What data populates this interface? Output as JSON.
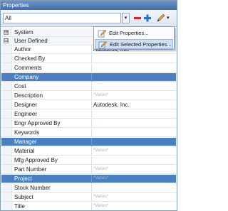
{
  "window": {
    "title": "Properties"
  },
  "toolbar": {
    "filter_value": "All"
  },
  "menu": {
    "items": [
      {
        "label": "Edit Properties..."
      },
      {
        "label": "Edit Selected Properties..."
      }
    ]
  },
  "groups": [
    {
      "label": "System",
      "expander": "⊞"
    },
    {
      "label": "User Defined",
      "expander": "⊟"
    }
  ],
  "properties": [
    {
      "name": "Author",
      "value": "Autodesk, Inc.",
      "varies": false,
      "selected": false
    },
    {
      "name": "Checked By",
      "value": "",
      "varies": false,
      "selected": false
    },
    {
      "name": "Comments",
      "value": "",
      "varies": false,
      "selected": false
    },
    {
      "name": "Company",
      "value": "",
      "varies": false,
      "selected": true
    },
    {
      "name": "Cost",
      "value": "",
      "varies": false,
      "selected": false
    },
    {
      "name": "Description",
      "value": "*Varies*",
      "varies": true,
      "selected": false
    },
    {
      "name": "Designer",
      "value": "Autodesk, Inc.",
      "varies": false,
      "selected": false
    },
    {
      "name": "Engineer",
      "value": "",
      "varies": false,
      "selected": false
    },
    {
      "name": "Engr Approved By",
      "value": "",
      "varies": false,
      "selected": false
    },
    {
      "name": "Keywords",
      "value": "",
      "varies": false,
      "selected": false
    },
    {
      "name": "Manager",
      "value": "",
      "varies": false,
      "selected": true
    },
    {
      "name": "Material",
      "value": "*Varies*",
      "varies": true,
      "selected": false
    },
    {
      "name": "Mfg Approved By",
      "value": "",
      "varies": false,
      "selected": false
    },
    {
      "name": "Part Number",
      "value": "*Varies*",
      "varies": true,
      "selected": false
    },
    {
      "name": "Project",
      "value": "*Varies*",
      "varies": true,
      "selected": true
    },
    {
      "name": "Stock Number",
      "value": "",
      "varies": false,
      "selected": false
    },
    {
      "name": "Subject",
      "value": "*Varies*",
      "varies": true,
      "selected": false
    },
    {
      "name": "Title",
      "value": "*Varies*",
      "varies": true,
      "selected": false
    }
  ],
  "colors": {
    "selection": "#4a7fc1",
    "titlebar": "#3f6ea8",
    "varies_text": "#b3b3b3"
  }
}
